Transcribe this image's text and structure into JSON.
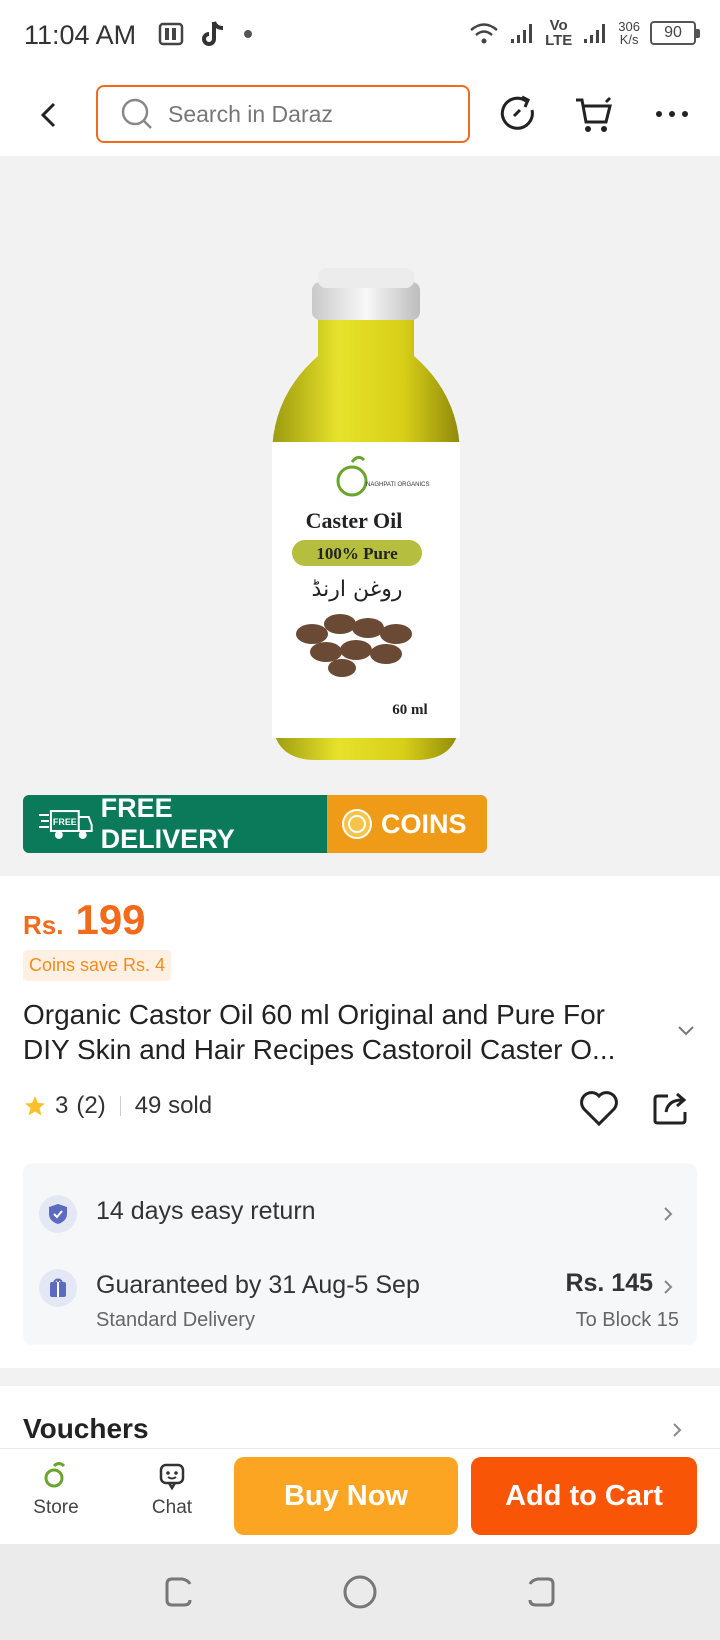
{
  "status_bar": {
    "time": "11:04 AM",
    "network_label_top": "Vo",
    "network_label_bottom": "LTE",
    "speed_value": "306",
    "speed_unit": "K/s",
    "battery": "90",
    "icons": [
      "notification-app-icon",
      "tiktok-icon",
      "dot-icon",
      "wifi-icon",
      "signal-icon",
      "signal-icon",
      "battery-icon"
    ]
  },
  "header": {
    "search_placeholder": "Search in Daraz",
    "icons": [
      "back-icon",
      "search-icon",
      "history-icon",
      "cart-icon",
      "more-icon"
    ]
  },
  "product_image": {
    "label_brand": "NAGHPATI ORGANICS",
    "label_title": "Caster Oil",
    "label_pure": "100% Pure",
    "label_urdu": "روغن ارنڈ",
    "label_volume": "60 ml"
  },
  "badges": {
    "free_tag": "FREE",
    "free_delivery": "FREE DELIVERY",
    "coins": "COINS"
  },
  "price": {
    "currency": "Rs.",
    "value": "199",
    "coins_save": "Coins save Rs. 4"
  },
  "product": {
    "title_line1": "Organic Castor Oil 60 ml Original and Pure For",
    "title_line2": "DIY Skin and Hair Recipes Castoroil Caster O...",
    "rating": "3",
    "rating_count": "(2)",
    "sold": "49 sold",
    "rating_fraction": 1.0
  },
  "info": {
    "return_text": "14 days easy return",
    "delivery_text": "Guaranteed by 31 Aug-5 Sep",
    "delivery_sub": "Standard Delivery",
    "delivery_fee": "Rs. 145",
    "delivery_to": "To Block 15"
  },
  "vouchers": {
    "label": "Vouchers"
  },
  "bottom_bar": {
    "store_label": "Store",
    "chat_label": "Chat",
    "buy_now": "Buy Now",
    "add_to_cart": "Add to Cart"
  },
  "colors": {
    "accent_orange": "#f85606",
    "buy_now": "#fba522",
    "price": "#f26b1d",
    "free_delivery_bg": "#0b7a5b",
    "coins_bg": "#f09b17"
  }
}
